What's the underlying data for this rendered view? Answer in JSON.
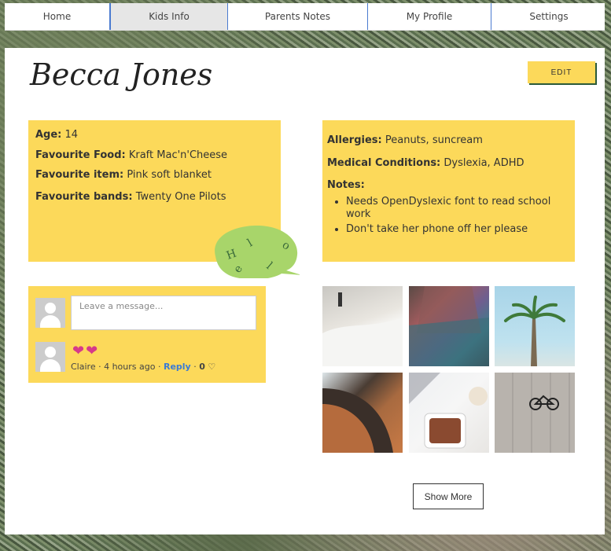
{
  "nav": {
    "items": [
      {
        "label": "Home"
      },
      {
        "label": "Kids Info",
        "active": true
      },
      {
        "label": "Parents Notes"
      },
      {
        "label": "My Profile"
      },
      {
        "label": "Settings"
      }
    ]
  },
  "profile": {
    "name": "Becca Jones",
    "edit_label": "EDIT"
  },
  "info_left": {
    "age_label": "Age:",
    "age_value": "14",
    "food_label": "Favourite Food:",
    "food_value": "Kraft Mac'n'Cheese",
    "item_label": "Favourite item:",
    "item_value": "Pink soft blanket",
    "bands_label": "Favourite bands:",
    "bands_value": "Twenty One Pilots"
  },
  "info_right": {
    "allergies_label": "Allergies:",
    "allergies_value": "Peanuts, suncream",
    "medical_label": "Medical Conditions:",
    "medical_value": "Dyslexia, ADHD",
    "notes_label": "Notes:",
    "notes": [
      "Needs OpenDyslexic font to read school work",
      "Don't take her phone off her please"
    ]
  },
  "bubble": {
    "letters": [
      "H",
      "e",
      "l",
      "l",
      "o"
    ],
    "color": "#a8d56a"
  },
  "comments": {
    "placeholder": "Leave a message...",
    "hearts": "❤❤",
    "author": "Claire",
    "time": "4 hours ago",
    "reply_label": "Reply",
    "likes": "0"
  },
  "gallery": {
    "photos": [
      "beach-walk-photo",
      "scarf-portrait-photo",
      "palm-tree-photo",
      "architecture-photo",
      "food-bowl-photo",
      "bicycle-photo"
    ]
  },
  "actions": {
    "show_more_label": "Show More"
  },
  "colors": {
    "accent_yellow": "#fcd95a",
    "link_blue": "#3a7bd5",
    "heart_pink": "#d63a8a"
  }
}
